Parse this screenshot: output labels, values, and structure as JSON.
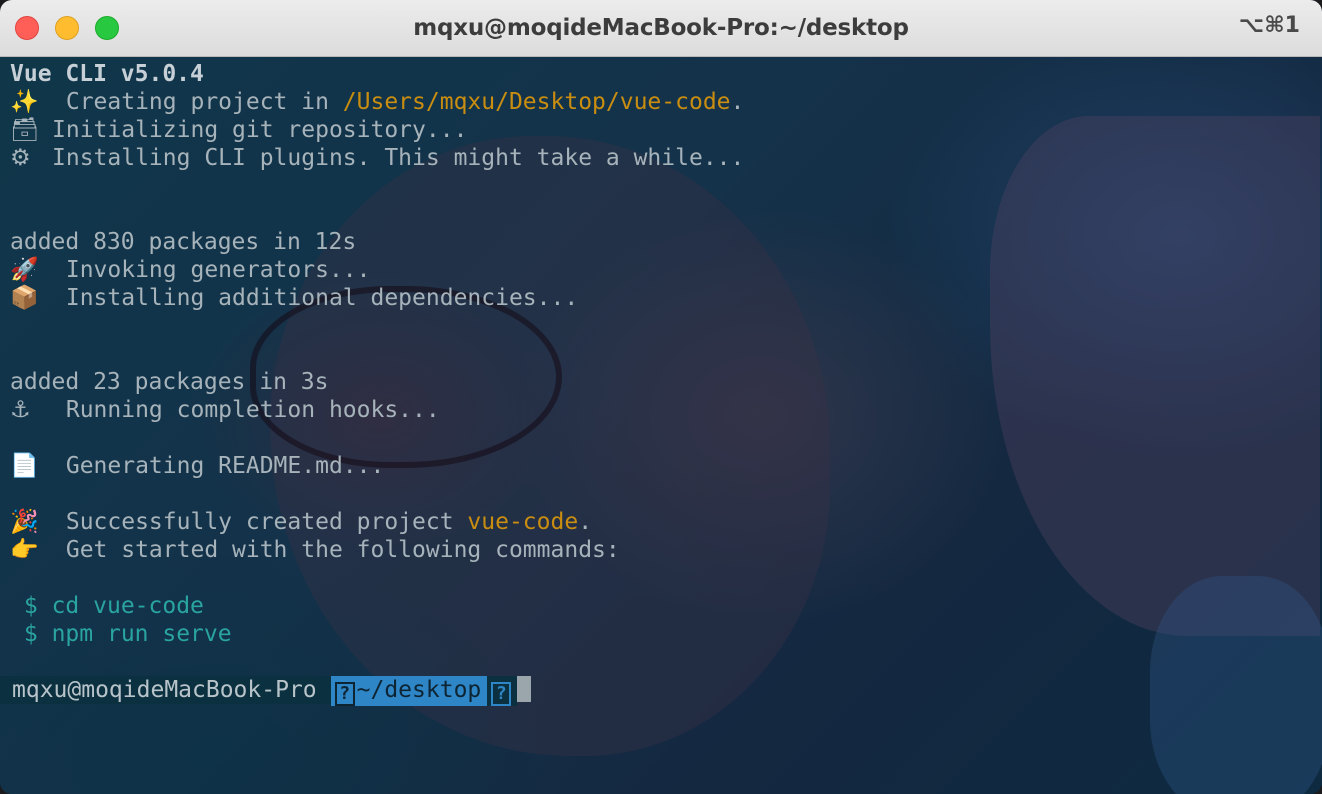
{
  "window": {
    "title": "mqxu@moqideMacBook-Pro:~/desktop",
    "shortcut": "⌥⌘1"
  },
  "terminal": {
    "header": "Vue CLI v5.0.4",
    "lines": [
      {
        "icon": "✨",
        "text": " Creating project in ",
        "accent": "/Users/mqxu/Desktop/vue-code",
        "tail": "."
      },
      {
        "icon": "🗃",
        "text": "Initializing git repository..."
      },
      {
        "icon": "⚙",
        "text": "Installing CLI plugins. This might take a while..."
      },
      {
        "text": "added 830 packages in 12s"
      },
      {
        "icon": "🚀",
        "text": " Invoking generators..."
      },
      {
        "icon": "📦",
        "text": " Installing additional dependencies..."
      },
      {
        "text": "added 23 packages in 3s"
      },
      {
        "icon": "⚓",
        "text": " Running completion hooks..."
      },
      {
        "icon": "📄",
        "text": " Generating README.md..."
      },
      {
        "icon": "🎉",
        "text": " Successfully created project ",
        "accent": "vue-code",
        "tail": "."
      },
      {
        "icon": "👉",
        "text": " Get started with the following commands:"
      }
    ],
    "commands": [
      {
        "prompt": "$",
        "cmd": "cd vue-code"
      },
      {
        "prompt": "$",
        "cmd": "npm run serve"
      }
    ],
    "prompt": {
      "user": "mqxu@moqideMacBook-Pro",
      "dir": "~/desktop",
      "glyph": "?"
    }
  },
  "colors": {
    "accent": "#c98d10",
    "command": "#2aa4a0",
    "prompt_dir_bg": "#2e86c7"
  }
}
